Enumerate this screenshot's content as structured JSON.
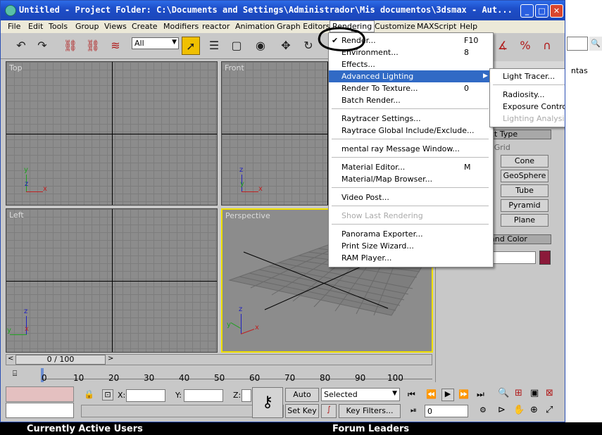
{
  "window": {
    "title": "Untitled   - Project Folder: C:\\Documents and Settings\\Administrador\\Mis documentos\\3dsmax   - Aut..."
  },
  "menubar": [
    "File",
    "Edit",
    "Tools",
    "Group",
    "Views",
    "Create",
    "Modifiers",
    "reactor",
    "Animation",
    "Graph Editors",
    "Rendering",
    "Customize",
    "MAXScript",
    "Help"
  ],
  "toolbar": {
    "selection_filter": "All"
  },
  "viewports": {
    "top": "Top",
    "front": "Front",
    "left": "Left",
    "perspective": "Perspective"
  },
  "axes": {
    "x": "x",
    "y": "y",
    "z": "z"
  },
  "rendering_menu": [
    {
      "label": "Render...",
      "shortcut": "F10",
      "checked": true
    },
    {
      "label": "Environment...",
      "shortcut": "8"
    },
    {
      "label": "Effects..."
    },
    {
      "label": "Advanced Lighting",
      "submenu": true,
      "highlighted": true
    },
    {
      "label": "Render To Texture...",
      "shortcut": "0"
    },
    {
      "label": "Batch Render..."
    },
    {
      "sep": true
    },
    {
      "label": "Raytracer Settings..."
    },
    {
      "label": "Raytrace Global Include/Exclude..."
    },
    {
      "sep": true
    },
    {
      "label": "mental ray Message Window..."
    },
    {
      "sep": true
    },
    {
      "label": "Material Editor...",
      "shortcut": "M"
    },
    {
      "label": "Material/Map Browser..."
    },
    {
      "sep": true
    },
    {
      "label": "Video Post..."
    },
    {
      "sep": true
    },
    {
      "label": "Show Last Rendering",
      "disabled": true
    },
    {
      "sep": true
    },
    {
      "label": "Panorama Exporter..."
    },
    {
      "label": "Print Size Wizard..."
    },
    {
      "label": "RAM Player..."
    }
  ],
  "advanced_lighting_submenu": [
    {
      "label": "Light Tracer..."
    },
    {
      "sep": true
    },
    {
      "label": "Radiosity..."
    },
    {
      "label": "Exposure Control..."
    },
    {
      "label": "Lighting Analysis...",
      "disabled": true
    }
  ],
  "command_panel": {
    "object_type_header": "ct Type",
    "autogrid": "oGrid",
    "buttons": [
      "Cone",
      "GeoSphere",
      "Tube",
      "Pyramid",
      "Plane"
    ],
    "name_color_header": "and Color",
    "swatch_color": "#8b1a3a",
    "right_edge_text": "ntas"
  },
  "timeline": {
    "frame_counter": "0 / 100",
    "ticks": [
      "0",
      "10",
      "20",
      "30",
      "40",
      "50",
      "60",
      "70",
      "80",
      "90",
      "100"
    ]
  },
  "status": {
    "x_label": "X:",
    "y_label": "Y:",
    "z_label": "Z:",
    "auto_key": "Auto Key",
    "set_key": "Set Key",
    "selected": "Selected",
    "key_filters": "Key Filters...",
    "current_frame": "0"
  },
  "forum": {
    "left": "Currently Active Users",
    "right": "Forum Leaders"
  }
}
